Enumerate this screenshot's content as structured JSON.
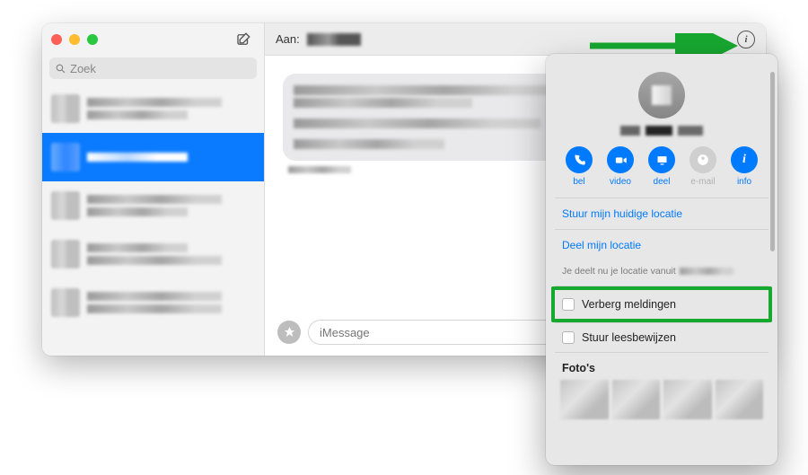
{
  "sidebar": {
    "search_placeholder": "Zoek"
  },
  "header": {
    "to_label": "Aan:"
  },
  "compose": {
    "placeholder": "iMessage"
  },
  "popover": {
    "actions": {
      "call": "bel",
      "video": "video",
      "share": "deel",
      "email": "e-mail",
      "info": "info"
    },
    "send_current_location": "Stuur mijn huidige locatie",
    "share_location": "Deel mijn locatie",
    "sharing_text_prefix": "Je deelt nu je locatie vanuit",
    "hide_notifications": "Verberg meldingen",
    "send_read_receipts": "Stuur leesbewijzen",
    "photos_title": "Foto's"
  }
}
